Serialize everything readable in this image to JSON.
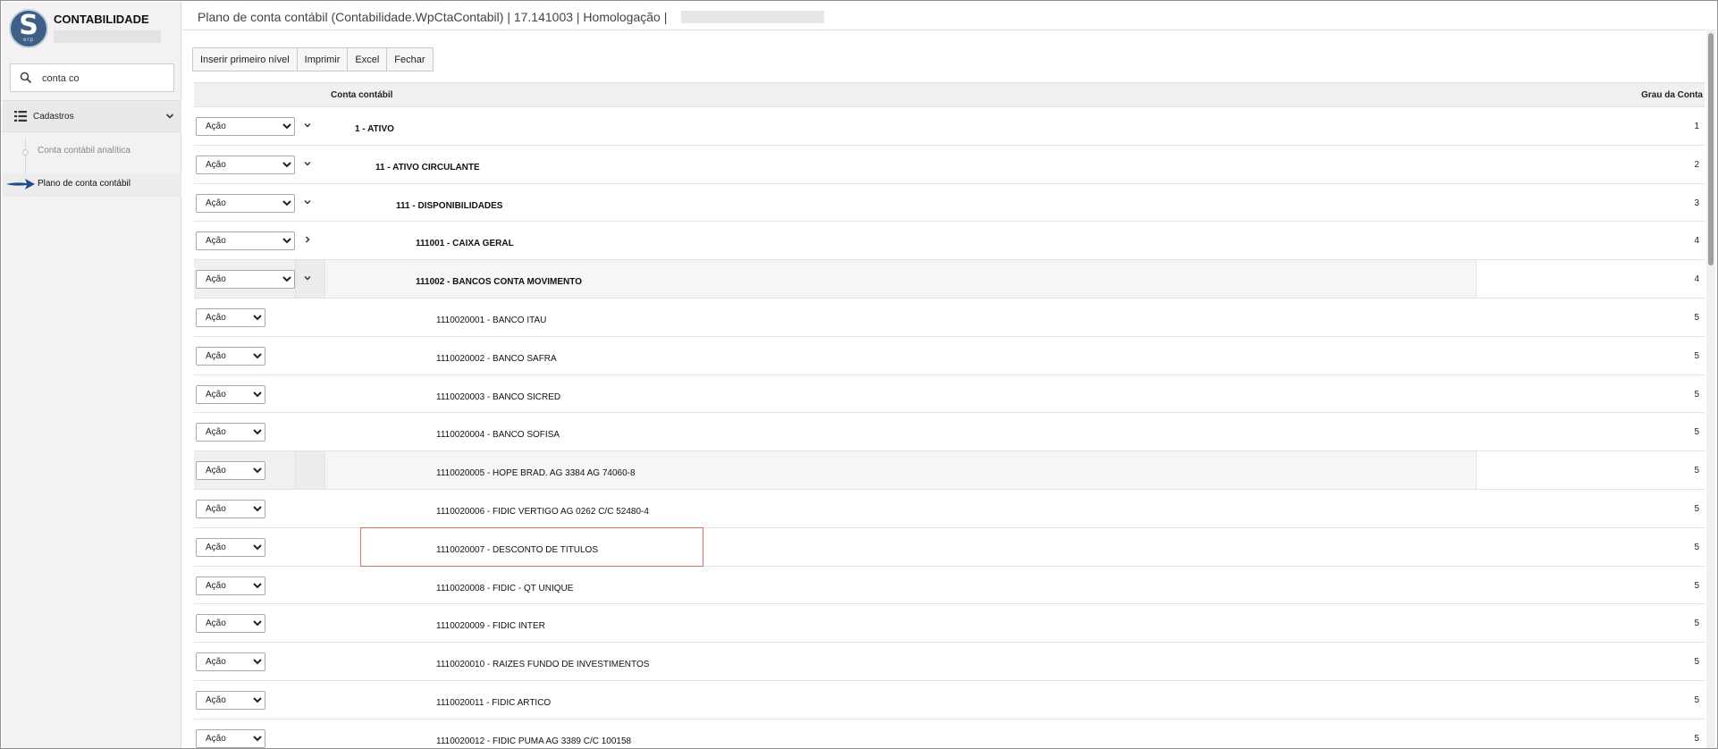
{
  "sidebar": {
    "app_title": "CONTABILIDADE",
    "logo_letter": "S",
    "logo_sub": "erp",
    "search": {
      "value": "conta co",
      "placeholder": ""
    },
    "nav_section": "Cadastros",
    "nav_items": [
      {
        "label": "Conta contábil analítica",
        "active": false
      },
      {
        "label": "Plano de conta contábil",
        "active": true
      }
    ]
  },
  "header": {
    "title": "Plano de conta contábil (Contabilidade.WpCtaContabil) | 17.141003 | Homologação |"
  },
  "toolbar": {
    "insert_label": "Inserir primeiro nível",
    "print_label": "Imprimir",
    "excel_label": "Excel",
    "close_label": "Fechar"
  },
  "grid": {
    "col_account": "Conta contábil",
    "col_grau": "Grau da Conta",
    "action_label": "Ação",
    "rows": [
      {
        "name": "1 - ATIVO",
        "grau": "1",
        "bold": true,
        "toggle": "expanded"
      },
      {
        "name": "11 - ATIVO CIRCULANTE",
        "grau": "2",
        "bold": true,
        "toggle": "expanded"
      },
      {
        "name": "111 - DISPONIBILIDADES",
        "grau": "3",
        "bold": true,
        "toggle": "expanded"
      },
      {
        "name": "111001 - CAIXA GERAL",
        "grau": "4",
        "bold": true,
        "toggle": "collapsed"
      },
      {
        "name": "111002 - BANCOS CONTA MOVIMENTO",
        "grau": "4",
        "bold": true,
        "toggle": "expanded"
      },
      {
        "name": "1110020001 - BANCO ITAU",
        "grau": "5",
        "bold": false,
        "toggle": "none"
      },
      {
        "name": "1110020002 - BANCO SAFRA",
        "grau": "5",
        "bold": false,
        "toggle": "none"
      },
      {
        "name": "1110020003 - BANCO SICRED",
        "grau": "5",
        "bold": false,
        "toggle": "none"
      },
      {
        "name": "1110020004 - BANCO SOFISA",
        "grau": "5",
        "bold": false,
        "toggle": "none"
      },
      {
        "name": "1110020005 - HOPE BRAD. AG 3384 AG 74060-8",
        "grau": "5",
        "bold": false,
        "toggle": "none"
      },
      {
        "name": "1110020006 - FIDIC VERTIGO AG 0262 C/C 52480-4",
        "grau": "5",
        "bold": false,
        "toggle": "none"
      },
      {
        "name": "1110020007 - DESCONTO DE TITULOS",
        "grau": "5",
        "bold": false,
        "toggle": "none"
      },
      {
        "name": "1110020008 - FIDIC - QT UNIQUE",
        "grau": "5",
        "bold": false,
        "toggle": "none"
      },
      {
        "name": "1110020009 - FIDIC INTER",
        "grau": "5",
        "bold": false,
        "toggle": "none"
      },
      {
        "name": "1110020010 - RAIZES FUNDO DE INVESTIMENTOS",
        "grau": "5",
        "bold": false,
        "toggle": "none"
      },
      {
        "name": "1110020011 - FIDIC ARTICO",
        "grau": "5",
        "bold": false,
        "toggle": "none"
      },
      {
        "name": "1110020012 - FIDIC PUMA AG 3389 C/C 100158",
        "grau": "5",
        "bold": false,
        "toggle": "none"
      }
    ]
  },
  "colors": {
    "logo": "#3f5f88",
    "highlight_border": "#e56a6a",
    "arrow": "#1f4e8c"
  }
}
